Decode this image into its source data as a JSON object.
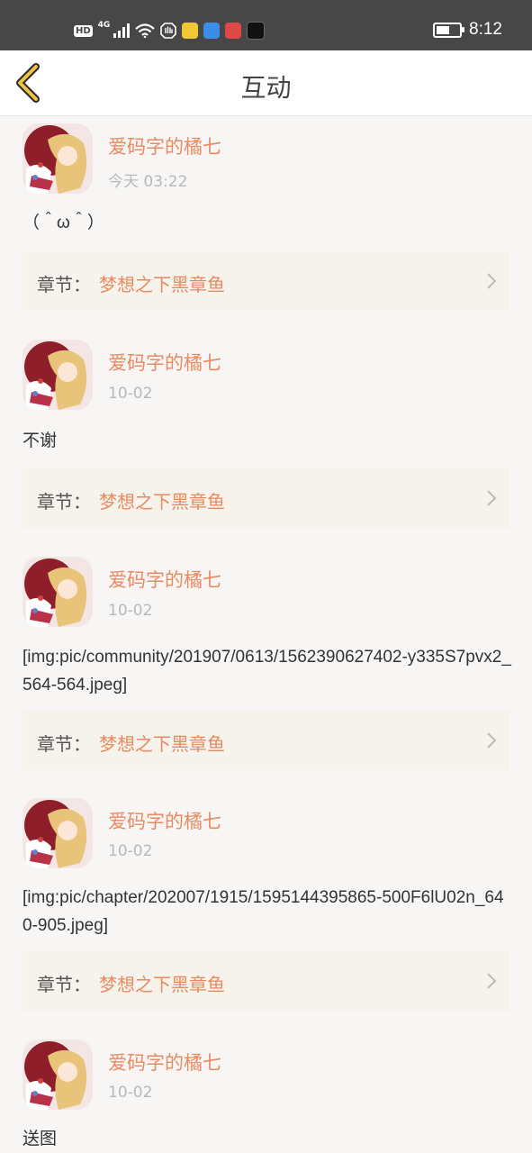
{
  "status_bar": {
    "network_badge": "HD",
    "network_type": "4G",
    "time": "8:12",
    "icons": [
      "hd-icon",
      "signal-icon",
      "wifi-icon",
      "hand-icon",
      "bulb-app-icon",
      "mail-app-icon",
      "book-app-icon",
      "tiktok-app-icon",
      "battery-icon"
    ]
  },
  "header": {
    "title": "互动",
    "back_icon": "chevron-left-icon"
  },
  "colors": {
    "accent": "#e98a5f",
    "timestamp": "#b8b8b8",
    "card_bg": "#f5f3ec",
    "page_bg": "#f7f6f5",
    "back_chevron": "#e9c24a"
  },
  "comments": [
    {
      "username": "爱码字的橘七",
      "time": "今天 03:22",
      "text": "（＾ω＾）",
      "chapter_label": "章节：",
      "chapter_name": "梦想之下黑章鱼"
    },
    {
      "username": "爱码字的橘七",
      "time": "10-02",
      "text": "不谢",
      "chapter_label": "章节：",
      "chapter_name": "梦想之下黑章鱼"
    },
    {
      "username": "爱码字的橘七",
      "time": "10-02",
      "text": "[img:pic/community/201907/0613/1562390627402-y335S7pvx2_564-564.jpeg]",
      "chapter_label": "章节：",
      "chapter_name": "梦想之下黑章鱼"
    },
    {
      "username": "爱码字的橘七",
      "time": "10-02",
      "text": "[img:pic/chapter/202007/1915/1595144395865-500F6lU02n_640-905.jpeg]",
      "chapter_label": "章节：",
      "chapter_name": "梦想之下黑章鱼"
    },
    {
      "username": "爱码字的橘七",
      "time": "10-02",
      "text": "送图"
    }
  ]
}
